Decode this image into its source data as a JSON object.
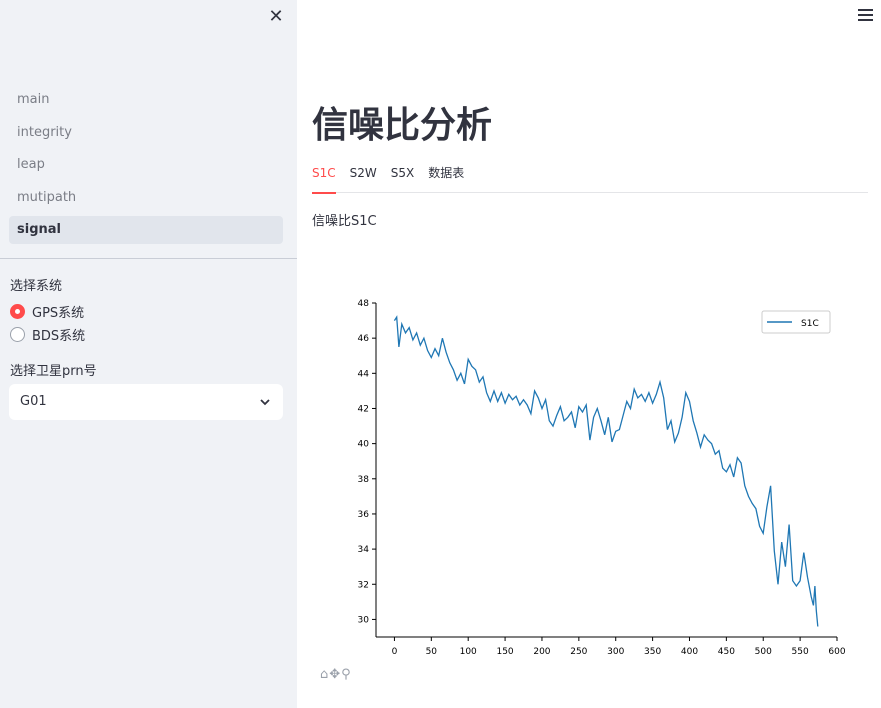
{
  "sidebar": {
    "nav": [
      {
        "label": "main"
      },
      {
        "label": "integrity"
      },
      {
        "label": "leap"
      },
      {
        "label": "mutipath"
      },
      {
        "label": "signal",
        "active": true
      }
    ],
    "system_label": "选择系统",
    "radio_options": [
      {
        "label": "GPS系统",
        "selected": true
      },
      {
        "label": "BDS系统",
        "selected": false
      }
    ],
    "prn_label": "选择卫星prn号",
    "prn_selected": "G01"
  },
  "main": {
    "title": "信噪比分析",
    "tabs": [
      {
        "label": "S1C",
        "active": true
      },
      {
        "label": "S2W"
      },
      {
        "label": "S5X"
      },
      {
        "label": "数据表"
      }
    ],
    "subtitle": "信噪比S1C"
  },
  "icons": [
    "close-icon",
    "hamburger-icon",
    "chevron-down-icon",
    "home-icon",
    "pan-icon",
    "zoom-icon"
  ],
  "colors": {
    "accent": "#ff4b4b",
    "line": "#1f77b4",
    "sidebar_bg": "#f0f2f6"
  },
  "chart_data": {
    "type": "line",
    "xlim": [
      -25,
      600
    ],
    "ylim": [
      29,
      48
    ],
    "xticks": [
      0,
      50,
      100,
      150,
      200,
      250,
      300,
      350,
      400,
      450,
      500,
      550,
      600
    ],
    "yticks": [
      30,
      32,
      34,
      36,
      38,
      40,
      42,
      44,
      46,
      48
    ],
    "legend_position": "top-right",
    "series": [
      {
        "name": "S1C",
        "x": [
          0,
          3,
          6,
          10,
          15,
          20,
          25,
          30,
          35,
          40,
          45,
          50,
          55,
          60,
          65,
          70,
          75,
          80,
          85,
          90,
          95,
          100,
          105,
          110,
          115,
          120,
          125,
          130,
          135,
          140,
          145,
          150,
          155,
          160,
          165,
          170,
          175,
          180,
          185,
          190,
          195,
          200,
          205,
          210,
          215,
          220,
          225,
          230,
          235,
          240,
          245,
          250,
          255,
          260,
          265,
          270,
          275,
          280,
          285,
          290,
          295,
          300,
          305,
          310,
          315,
          320,
          325,
          330,
          335,
          340,
          345,
          350,
          355,
          360,
          365,
          370,
          375,
          380,
          385,
          390,
          395,
          400,
          405,
          410,
          415,
          420,
          425,
          430,
          435,
          440,
          445,
          450,
          455,
          460,
          465,
          470,
          475,
          480,
          485,
          490,
          495,
          500,
          505,
          510,
          515,
          520,
          525,
          530,
          535,
          540,
          545,
          550,
          555,
          560,
          565,
          568,
          570,
          572,
          574
        ],
        "values": [
          47.0,
          47.2,
          45.5,
          46.8,
          46.3,
          46.6,
          45.9,
          46.3,
          45.6,
          46.0,
          45.3,
          44.9,
          45.4,
          45.0,
          46.0,
          45.2,
          44.6,
          44.2,
          43.6,
          44.0,
          43.4,
          44.8,
          44.4,
          44.2,
          43.5,
          43.8,
          42.9,
          42.4,
          43.0,
          42.4,
          42.9,
          42.3,
          42.8,
          42.5,
          42.7,
          42.2,
          42.5,
          42.2,
          41.7,
          43.0,
          42.6,
          42.0,
          42.5,
          41.3,
          41.0,
          41.6,
          42.1,
          41.3,
          41.5,
          41.8,
          40.9,
          42.1,
          41.8,
          42.2,
          40.2,
          41.5,
          42.0,
          41.3,
          40.5,
          41.5,
          40.1,
          40.7,
          40.8,
          41.6,
          42.4,
          42.0,
          43.1,
          42.6,
          42.8,
          42.4,
          42.9,
          42.3,
          42.8,
          43.5,
          42.6,
          40.8,
          41.3,
          40.1,
          40.6,
          41.5,
          42.9,
          42.4,
          41.3,
          40.6,
          39.8,
          40.5,
          40.2,
          40.0,
          39.4,
          39.6,
          38.6,
          38.4,
          38.8,
          38.1,
          39.2,
          38.9,
          37.6,
          37.0,
          36.6,
          36.3,
          35.3,
          34.9,
          36.4,
          37.6,
          33.9,
          32.0,
          34.4,
          33.0,
          35.4,
          32.2,
          31.9,
          32.2,
          33.8,
          32.4,
          31.3,
          30.8,
          31.9,
          30.5,
          29.6
        ]
      }
    ]
  }
}
